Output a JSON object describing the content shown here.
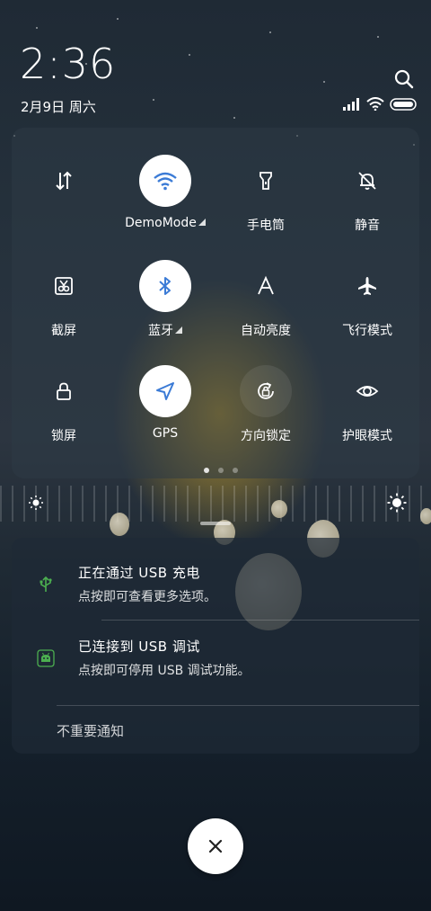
{
  "status": {
    "time": "2:36",
    "date": "2月9日 周六"
  },
  "quick_settings": {
    "tiles": [
      {
        "label": "",
        "icon": "data-toggle-icon",
        "on": false
      },
      {
        "label": "DemoMode",
        "icon": "wifi-icon",
        "on": true
      },
      {
        "label": "手电筒",
        "icon": "flashlight-icon",
        "on": false
      },
      {
        "label": "静音",
        "icon": "bell-off-icon",
        "on": false
      },
      {
        "label": "截屏",
        "icon": "screenshot-icon",
        "on": false
      },
      {
        "label": "蓝牙",
        "icon": "bluetooth-icon",
        "on": true
      },
      {
        "label": "自动亮度",
        "icon": "auto-brightness-icon",
        "on": false
      },
      {
        "label": "飞行模式",
        "icon": "airplane-icon",
        "on": false
      },
      {
        "label": "锁屏",
        "icon": "lock-icon",
        "on": false
      },
      {
        "label": "GPS",
        "icon": "location-icon",
        "on": true
      },
      {
        "label": "方向锁定",
        "icon": "rotation-lock-icon",
        "on": false
      },
      {
        "label": "护眼模式",
        "icon": "eye-icon",
        "on": false
      }
    ],
    "page_count": 3,
    "active_page": 1
  },
  "notifications": [
    {
      "title": "正在通过 USB 充电",
      "subtitle": "点按即可查看更多选项。",
      "icon": "usb-charge-icon"
    },
    {
      "title": "已连接到 USB 调试",
      "subtitle": "点按即可停用 USB 调试功能。",
      "icon": "android-debug-icon"
    }
  ],
  "unimportant_label": "不重要通知",
  "colors": {
    "accent_blue": "#3b7bd6",
    "tile_on_bg": "#ffffff",
    "usb_icon_green": "#4caf50"
  }
}
